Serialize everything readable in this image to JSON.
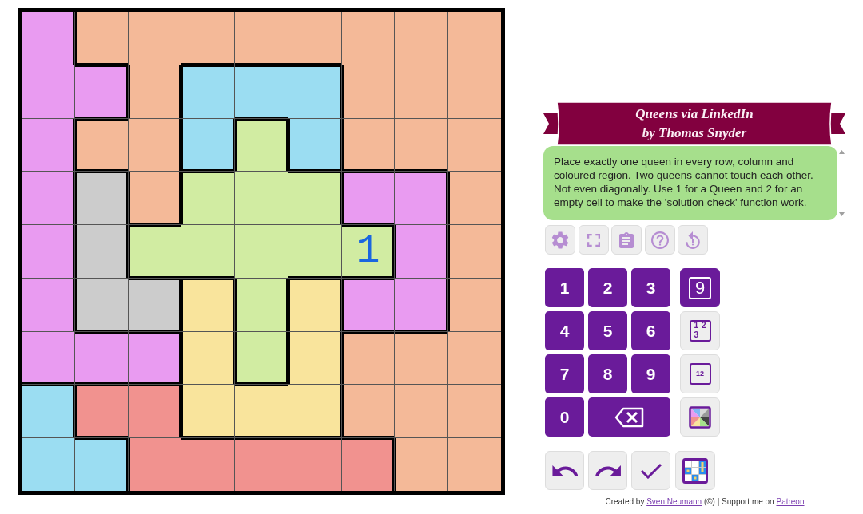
{
  "grid": {
    "rows": [
      [
        {
          "color": "#e99bf1"
        },
        {
          "color": "#f4b998"
        },
        {
          "color": "#f4b998"
        },
        {
          "color": "#f4b998"
        },
        {
          "color": "#f4b998"
        },
        {
          "color": "#f4b998"
        },
        {
          "color": "#f4b998"
        },
        {
          "color": "#f4b998"
        },
        {
          "color": "#f4b998"
        }
      ],
      [
        {
          "color": "#e99bf1"
        },
        {
          "color": "#e99bf1"
        },
        {
          "color": "#f4b998"
        },
        {
          "color": "#9bddf2"
        },
        {
          "color": "#9bddf2"
        },
        {
          "color": "#9bddf2"
        },
        {
          "color": "#f4b998"
        },
        {
          "color": "#f4b998"
        },
        {
          "color": "#f4b998"
        }
      ],
      [
        {
          "color": "#e99bf1"
        },
        {
          "color": "#f4b998"
        },
        {
          "color": "#f4b998"
        },
        {
          "color": "#9bddf2"
        },
        {
          "color": "#d1eca2"
        },
        {
          "color": "#9bddf2"
        },
        {
          "color": "#f4b998"
        },
        {
          "color": "#f4b998"
        },
        {
          "color": "#f4b998"
        }
      ],
      [
        {
          "color": "#e99bf1"
        },
        {
          "color": "#cccccc"
        },
        {
          "color": "#f4b998"
        },
        {
          "color": "#d1eca2"
        },
        {
          "color": "#d1eca2"
        },
        {
          "color": "#d1eca2"
        },
        {
          "color": "#e99bf1"
        },
        {
          "color": "#e99bf1"
        },
        {
          "color": "#f4b998"
        }
      ],
      [
        {
          "color": "#e99bf1"
        },
        {
          "color": "#cccccc"
        },
        {
          "color": "#d1eca2"
        },
        {
          "color": "#d1eca2"
        },
        {
          "color": "#d1eca2"
        },
        {
          "color": "#d1eca2"
        },
        {
          "color": "#d1eca2",
          "value": "1"
        },
        {
          "color": "#e99bf1"
        },
        {
          "color": "#f4b998"
        }
      ],
      [
        {
          "color": "#e99bf1"
        },
        {
          "color": "#cccccc"
        },
        {
          "color": "#cccccc"
        },
        {
          "color": "#f9e49c"
        },
        {
          "color": "#d1eca2"
        },
        {
          "color": "#f9e49c"
        },
        {
          "color": "#e99bf1"
        },
        {
          "color": "#e99bf1"
        },
        {
          "color": "#f4b998"
        }
      ],
      [
        {
          "color": "#e99bf1"
        },
        {
          "color": "#e99bf1"
        },
        {
          "color": "#e99bf1"
        },
        {
          "color": "#f9e49c"
        },
        {
          "color": "#d1eca2"
        },
        {
          "color": "#f9e49c"
        },
        {
          "color": "#f4b998"
        },
        {
          "color": "#f4b998"
        },
        {
          "color": "#f4b998"
        }
      ],
      [
        {
          "color": "#9bddf2"
        },
        {
          "color": "#f1928f"
        },
        {
          "color": "#f1928f"
        },
        {
          "color": "#f9e49c"
        },
        {
          "color": "#f9e49c"
        },
        {
          "color": "#f9e49c"
        },
        {
          "color": "#f4b998"
        },
        {
          "color": "#f4b998"
        },
        {
          "color": "#f4b998"
        }
      ],
      [
        {
          "color": "#9bddf2"
        },
        {
          "color": "#9bddf2"
        },
        {
          "color": "#f1928f"
        },
        {
          "color": "#f1928f"
        },
        {
          "color": "#f1928f"
        },
        {
          "color": "#f1928f"
        },
        {
          "color": "#f1928f"
        },
        {
          "color": "#f4b998"
        },
        {
          "color": "#f4b998"
        }
      ]
    ]
  },
  "banner": {
    "lines": [
      "Queens via LinkedIn",
      "by Thomas Snyder"
    ]
  },
  "instructions": "Place exactly one queen in every row, column and coloured region. Two queens cannot touch each other. Not even diagonally. Use 1 for a Queen and 2 for an empty cell to make the 'solution check' function work.",
  "keypad": {
    "keys": [
      "1",
      "2",
      "3",
      "4",
      "5",
      "6",
      "7",
      "8",
      "9",
      "0"
    ]
  },
  "modes": [
    {
      "kind": "digit",
      "text": "9",
      "selected": true
    },
    {
      "kind": "corner",
      "marks": [
        "1",
        "2",
        "3"
      ],
      "selected": false
    },
    {
      "kind": "center",
      "text": "12",
      "selected": false
    },
    {
      "kind": "color",
      "selected": false
    }
  ],
  "footer": {
    "before": "Created by",
    "author": "Sven Neumann",
    "middle": "(©) | Support me on",
    "support_link": "Patreon"
  }
}
